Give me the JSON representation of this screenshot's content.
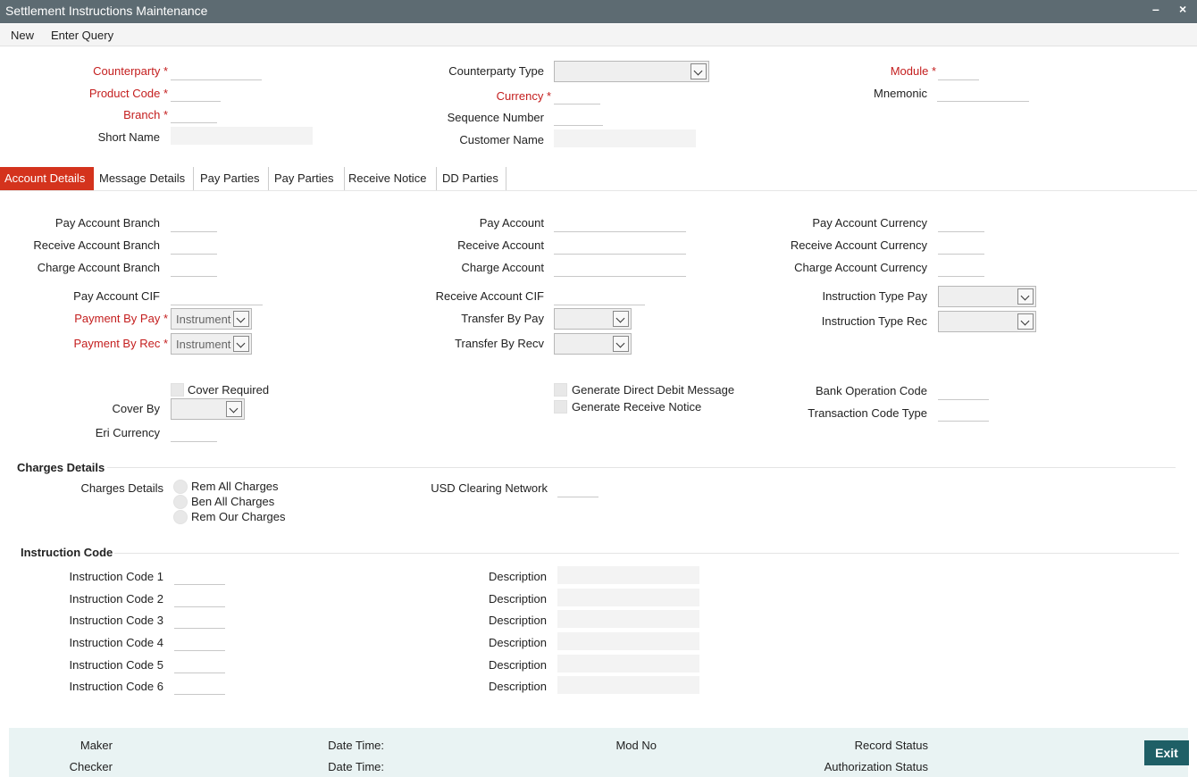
{
  "window": {
    "title": "Settlement Instructions Maintenance",
    "minimize": "–",
    "close": "×"
  },
  "menu": {
    "new": "New",
    "enter_query": "Enter Query"
  },
  "header": {
    "counterparty": "Counterparty",
    "product_code": "Product Code",
    "branch": "Branch",
    "short_name": "Short Name",
    "counterparty_type": "Counterparty Type",
    "currency": "Currency",
    "sequence_number": "Sequence Number",
    "customer_name": "Customer Name",
    "module": "Module",
    "mnemonic": "Mnemonic"
  },
  "tabs": [
    {
      "label": "Account Details",
      "active": true
    },
    {
      "label": "Message Details"
    },
    {
      "label": "Pay Parties"
    },
    {
      "label": "Pay Parties"
    },
    {
      "label": "Receive Notice"
    },
    {
      "label": "DD Parties"
    }
  ],
  "account": {
    "pay_account_branch": "Pay Account Branch",
    "receive_account_branch": "Receive Account Branch",
    "charge_account_branch": "Charge Account Branch",
    "pay_account": "Pay Account",
    "receive_account": "Receive Account",
    "charge_account": "Charge Account",
    "pay_account_currency": "Pay Account Currency",
    "receive_account_currency": "Receive Account Currency",
    "charge_account_currency": "Charge Account Currency",
    "pay_account_cif": "Pay Account CIF",
    "payment_by_pay": "Payment By Pay",
    "payment_by_pay_value": "Instrument",
    "payment_by_rec": "Payment By Rec",
    "payment_by_rec_value": "Instrument",
    "receive_account_cif": "Receive Account CIF",
    "transfer_by_pay": "Transfer By Pay",
    "transfer_by_recv": "Transfer By Recv",
    "instruction_type_pay": "Instruction Type Pay",
    "instruction_type_rec": "Instruction Type Rec",
    "cover_required": "Cover Required",
    "cover_by": "Cover By",
    "eri_currency": "Eri Currency",
    "generate_dd_message": "Generate Direct Debit Message",
    "generate_receive_notice": "Generate Receive Notice",
    "bank_operation_code": "Bank Operation Code",
    "transaction_code_type": "Transaction Code Type"
  },
  "charges": {
    "section_title": "Charges Details",
    "label": "Charges Details",
    "options": [
      "Rem All Charges",
      "Ben All Charges",
      "Rem Our Charges"
    ],
    "usd_clearing_network": "USD Clearing Network"
  },
  "instruction": {
    "section_title": "Instruction Code",
    "codes": [
      "Instruction Code 1",
      "Instruction Code 2",
      "Instruction Code 3",
      "Instruction Code 4",
      "Instruction Code 5",
      "Instruction Code 6"
    ],
    "description": "Description"
  },
  "footer": {
    "maker": "Maker",
    "checker": "Checker",
    "date_time": "Date Time:",
    "mod_no": "Mod No",
    "record_status": "Record Status",
    "authorization_status": "Authorization Status",
    "exit": "Exit"
  }
}
